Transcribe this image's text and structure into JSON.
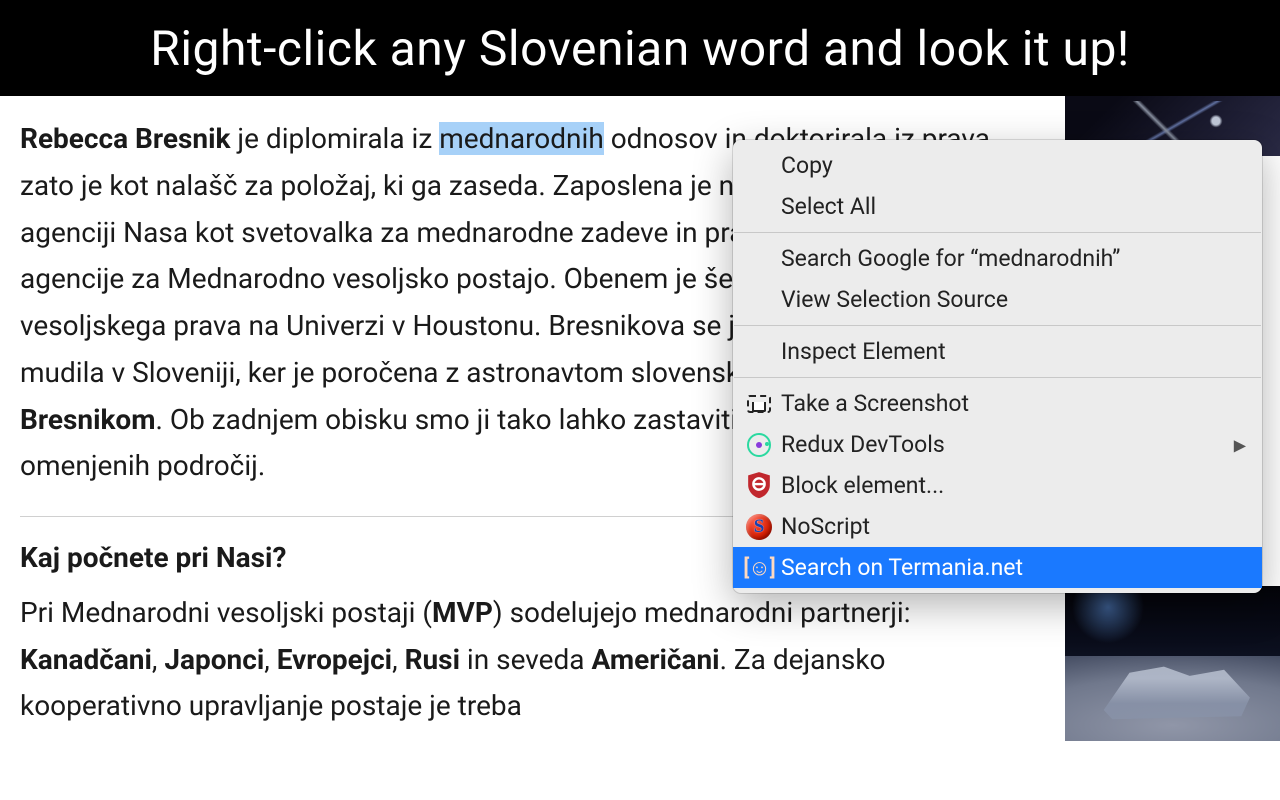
{
  "banner": {
    "text": "Right-click any Slovenian word and look it up!"
  },
  "article": {
    "p1_strong1": "Rebecca Bresnik",
    "p1_a": " je diplomirala iz ",
    "p1_highlight": "mednarodnih",
    "p1_b": " odnosov in doktorirala iz prava, zato je kot nalašč za položaj, ki ga zaseda. Zaposlena je na ameriški vesoljski agenciji Nasa kot svetovalka za mednarodne zadeve in pravna zastopnica agencije za Mednarodno vesoljsko postajo. Obenem je še profesorica vesoljskega prava na Univerzi v Houstonu. Bresnikova se je v zadnjih letih večkrat mudila v Sloveniji, ker je poročena z astronavtom slovenskega rodu ",
    "p1_strong2": "Randyjem Bresnikom",
    "p1_c": ". Ob zadnjem obisku smo ji tako lahko zastaviti nekaj vprašanj z vseh omenjenih področij.",
    "p2_strong1": "Kaj počnete pri Nasi?",
    "p3_a": "Pri Mednarodni vesoljski postaji (",
    "p3_strong1": "MVP",
    "p3_b": ") sodelujejo mednarodni partnerji: ",
    "p3_strong2": "Kanadčani",
    "p3_c": ", ",
    "p3_strong3": "Japonci",
    "p3_d": ", ",
    "p3_strong4": "Evropejci",
    "p3_e": ", ",
    "p3_strong5": "Rusi",
    "p3_f": " in seveda ",
    "p3_strong6": "Američani",
    "p3_g": ". Za dejansko kooperativno upravljanje postaje je treba"
  },
  "context_menu": {
    "copy": "Copy",
    "select_all": "Select All",
    "search_google": "Search Google for “mednarodnih”",
    "view_source": "View Selection Source",
    "inspect": "Inspect Element",
    "screenshot": "Take a Screenshot",
    "redux": "Redux DevTools",
    "ublock": "Block element...",
    "noscript": "NoScript",
    "termania": "Search on Termania.net"
  }
}
